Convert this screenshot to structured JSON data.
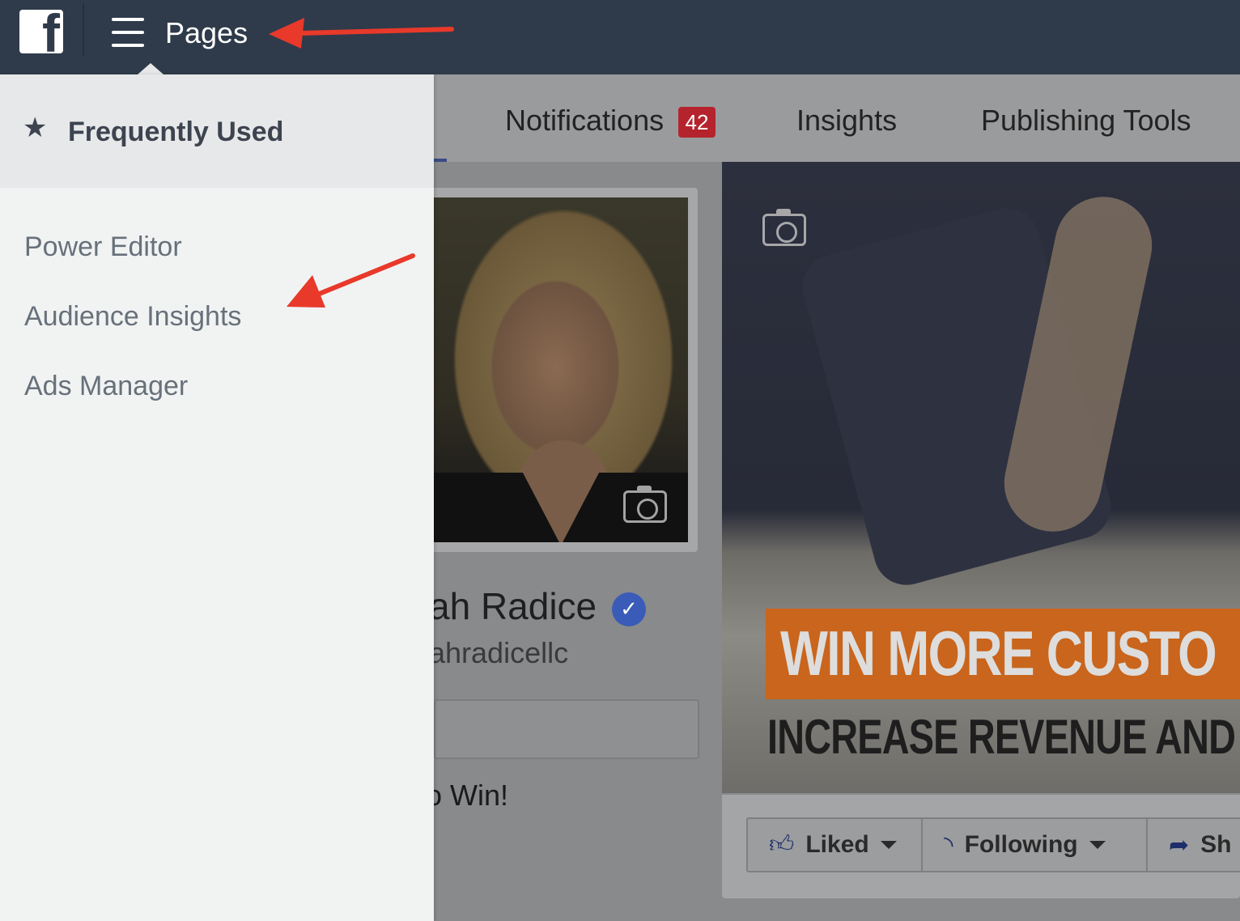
{
  "topbar": {
    "logo_letter": "f",
    "title": "Pages"
  },
  "menu": {
    "header": "Frequently Used",
    "items": [
      {
        "label": "Power Editor"
      },
      {
        "label": "Audience Insights"
      },
      {
        "label": "Ads Manager"
      }
    ]
  },
  "tabs": [
    {
      "label": "Notifications",
      "badge": "42"
    },
    {
      "label": "Insights"
    },
    {
      "label": "Publishing Tools"
    }
  ],
  "profile": {
    "name_partial": "ah Radice",
    "handle_partial": "ahradicellc",
    "about_partial": "o Win!"
  },
  "cover": {
    "line1": "WIN MORE CUSTO",
    "line2": "INCREASE REVENUE AND GA"
  },
  "actions": [
    {
      "label": "Liked",
      "icon": "thumbs-up-icon"
    },
    {
      "label": "Following",
      "icon": "rss-icon"
    },
    {
      "label": "Sh",
      "icon": "share-arrow-icon"
    }
  ],
  "colors": {
    "topbar": "#2f3b4a",
    "menu_bg": "#f1f3f3",
    "badge": "#b5242d",
    "annotation_arrow": "#e8392b",
    "banner_orange": "#c9651c"
  }
}
